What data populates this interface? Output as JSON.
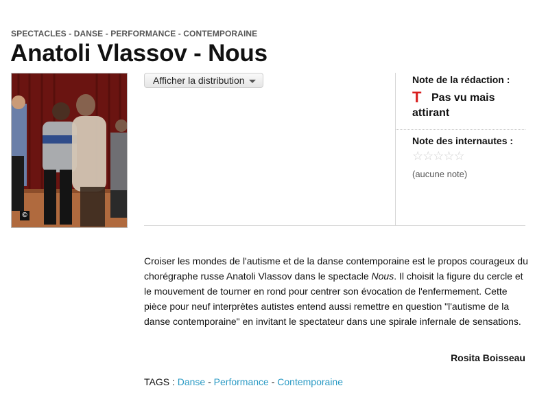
{
  "header": {
    "breadcrumb": "SPECTACLES  - DANSE - PERFORMANCE - CONTEMPORAINE",
    "title": "Anatoli Vlassov - Nous"
  },
  "photo": {
    "copyright_symbol": "©"
  },
  "distribution": {
    "button_label": "Afficher la distribution",
    "icon": "chevron-down-icon"
  },
  "ratings": {
    "editor_label": "Note de la rédaction :",
    "editor_icon": "T",
    "editor_icon_color": "#d81e1e",
    "editor_verdict": "Pas vu mais attirant",
    "users_label": "Note des internautes :",
    "users_stars": "☆☆☆☆☆",
    "users_value": 0,
    "users_max": 5,
    "users_none": "(aucune note)"
  },
  "article": {
    "part1": "Croiser les mondes de l'autisme et de la danse contemporaine est le propos courageux du chorégraphe russe Anatoli Vlassov dans le spectacle ",
    "work_title": "Nous",
    "part2": ". Il choisit la figure du cercle et le mouvement de tourner en rond pour centrer son évocation de l'enfermement. Cette pièce pour neuf interprètes autistes entend aussi remettre en question \"l'autisme de la danse contemporaine\" en invitant le spectateur dans une spirale infernale de sensations.",
    "author": "Rosita Boisseau"
  },
  "tags": {
    "label": "TAGS : ",
    "separator": " - ",
    "items": [
      "Danse",
      "Performance",
      "Contemporaine"
    ],
    "link_color": "#2a9ac4"
  }
}
